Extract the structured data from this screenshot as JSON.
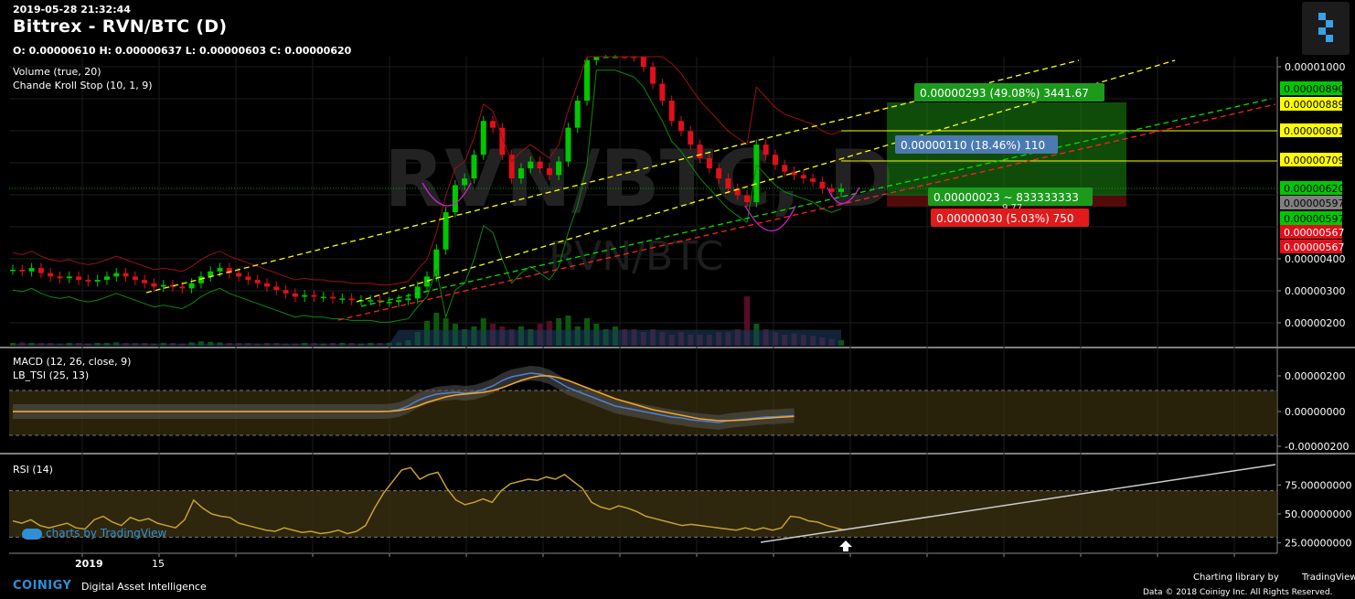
{
  "header": {
    "date": "2019-05-28 21:32:44",
    "title": "Bittrex - RVN/BTC (D)",
    "ohlc": "O: 0.00000610 H: 0.00000637 L: 0.00000603 C: 0.00000620"
  },
  "indicators": {
    "volume": "Volume (true, 20)",
    "chande": "Chande Kroll Stop (10, 1, 9)",
    "macd": "MACD (12, 26, close, 9)",
    "tsi": "LB_TSI (25, 13)",
    "rsi": "RSI (14)"
  },
  "watermark": {
    "big": "RVN/BTC, D",
    "small": "RVN/BTC"
  },
  "tv_watermark": "charts by TradingView",
  "footer": {
    "brand": "COINIGY",
    "tagline": "Digital Asset Intelligence",
    "charting": "Charting library by",
    "tv": "TradingView",
    "copyright": "Data © 2018 Coinigy Inc. All Rights Reserved."
  },
  "colors": {
    "up": "#00c800",
    "down": "#e0101b",
    "yellow_dash": "#ffff00",
    "green_dash": "#00e000",
    "red_dash": "#ff2020",
    "profit_zone": "#1c8a12",
    "loss_zone": "#8a1010",
    "macd_line": "#4f7fd8",
    "signal_line": "#f5a623",
    "rsi_line": "#c8a030",
    "rsi_band": "#3a3010",
    "axis_text": "#ffffff"
  },
  "chart_data": [
    {
      "type": "candlestick",
      "title": "Bittrex - RVN/BTC (D)",
      "ylim": [
        1.5e-06,
        1.01e-05
      ],
      "price_axis_ticks": [
        "0.00001000",
        "0.00000300",
        "0.00000200",
        "0.00000400"
      ],
      "x_tick_labels": [
        "2019",
        "15"
      ],
      "price_markers": [
        {
          "label": "0.00000890",
          "color": "#00c800"
        },
        {
          "label": "0.00000889",
          "color": "#ffff00"
        },
        {
          "label": "0.00000801",
          "color": "#ffff00"
        },
        {
          "label": "0.00000709",
          "color": "#ffff00"
        },
        {
          "label": "0.00000620",
          "color": "#00c800"
        },
        {
          "label": "0.00000597",
          "color": "#808080"
        },
        {
          "label": "0.00000597",
          "color": "#00c800"
        },
        {
          "label": "0.00000567",
          "color": "#e0101b"
        },
        {
          "label": "0.00000567",
          "color": "#e0101b"
        }
      ],
      "position": {
        "target_label": "0.00000293 (49.08%) 3441.67",
        "mid_label": "0.00000110 (18.46%) 110",
        "entry_label": "0.00000023 ~ 833333333",
        "ratio": "9.77",
        "stop_label": "0.00000030 (5.03%) 750"
      },
      "close_series": [
        3.8,
        3.75,
        3.85,
        3.7,
        3.6,
        3.55,
        3.6,
        3.5,
        3.45,
        3.5,
        3.6,
        3.7,
        3.6,
        3.5,
        3.4,
        3.3,
        3.35,
        3.3,
        3.25,
        3.4,
        3.6,
        3.75,
        3.85,
        3.7,
        3.6,
        3.5,
        3.4,
        3.3,
        3.2,
        3.1,
        3.0,
        3.05,
        3.0,
        3.0,
        2.95,
        2.95,
        2.9,
        2.9,
        2.9,
        2.85,
        2.85,
        2.9,
        2.95,
        3.3,
        3.6,
        4.4,
        5.5,
        6.3,
        6.5,
        7.2,
        8.2,
        8.0,
        7.2,
        6.5,
        6.8,
        7.0,
        6.8,
        6.6,
        7.0,
        8.0,
        8.8,
        10.0,
        10.3,
        10.3,
        10.3,
        10.2,
        10.1,
        9.8,
        9.3,
        8.8,
        8.2,
        7.9,
        7.5,
        7.1,
        6.8,
        6.5,
        6.2,
        6.0,
        5.8,
        7.5,
        7.2,
        6.9,
        6.7,
        6.6,
        6.5,
        6.4,
        6.2,
        6.1,
        6.2
      ],
      "volume": [
        0.05,
        0.06,
        0.05,
        0.05,
        0.05,
        0.04,
        0.05,
        0.05,
        0.04,
        0.05,
        0.05,
        0.06,
        0.05,
        0.05,
        0.05,
        0.04,
        0.05,
        0.05,
        0.04,
        0.06,
        0.08,
        0.07,
        0.06,
        0.05,
        0.05,
        0.05,
        0.04,
        0.05,
        0.05,
        0.04,
        0.04,
        0.05,
        0.05,
        0.04,
        0.05,
        0.05,
        0.05,
        0.04,
        0.05,
        0.05,
        0.05,
        0.06,
        0.1,
        0.25,
        0.45,
        0.6,
        0.5,
        0.4,
        0.3,
        0.35,
        0.5,
        0.4,
        0.35,
        0.3,
        0.35,
        0.3,
        0.4,
        0.45,
        0.5,
        0.55,
        0.35,
        0.5,
        0.4,
        0.3,
        0.35,
        0.3,
        0.3,
        0.25,
        0.3,
        0.25,
        0.2,
        0.25,
        0.2,
        0.2,
        0.2,
        0.25,
        0.25,
        0.3,
        0.9,
        0.4,
        0.3,
        0.25,
        0.2,
        0.22,
        0.2,
        0.18,
        0.15,
        0.12,
        0.1
      ]
    },
    {
      "type": "line",
      "title": "MACD (12, 26, close, 9)",
      "y_tick_labels": [
        "0.00000200",
        "0.00000000",
        "-0.00000200"
      ],
      "series": [
        {
          "name": "MACD",
          "values": [
            0,
            0,
            0,
            0,
            0,
            0,
            0,
            0,
            0,
            0,
            0,
            0,
            0,
            0,
            0,
            0,
            0,
            0,
            0,
            0,
            0,
            0,
            0,
            0,
            0,
            0,
            0,
            0,
            0,
            0,
            0,
            0,
            0,
            0,
            0,
            0,
            0,
            0,
            0,
            0,
            0.02,
            0.1,
            0.3,
            0.6,
            0.8,
            0.95,
            1.0,
            1.05,
            1.0,
            1.05,
            1.2,
            1.4,
            1.7,
            1.9,
            2.0,
            2.1,
            2.05,
            1.9,
            1.6,
            1.3,
            1.1,
            0.9,
            0.7,
            0.5,
            0.3,
            0.2,
            0.1,
            0,
            -0.1,
            -0.2,
            -0.3,
            -0.35,
            -0.45,
            -0.5,
            -0.55,
            -0.6,
            -0.5,
            -0.45,
            -0.4,
            -0.35,
            -0.3,
            -0.28,
            -0.25,
            -0.22
          ]
        },
        {
          "name": "Signal",
          "values": [
            0,
            0,
            0,
            0,
            0,
            0,
            0,
            0,
            0,
            0,
            0,
            0,
            0,
            0,
            0,
            0,
            0,
            0,
            0,
            0,
            0,
            0,
            0,
            0,
            0,
            0,
            0,
            0,
            0,
            0,
            0,
            0,
            0,
            0,
            0,
            0,
            0,
            0,
            0,
            0,
            0.01,
            0.05,
            0.15,
            0.3,
            0.5,
            0.65,
            0.8,
            0.9,
            0.95,
            1.0,
            1.05,
            1.15,
            1.3,
            1.5,
            1.7,
            1.85,
            1.95,
            1.95,
            1.85,
            1.7,
            1.5,
            1.3,
            1.1,
            0.9,
            0.7,
            0.55,
            0.4,
            0.25,
            0.1,
            0,
            -0.1,
            -0.2,
            -0.3,
            -0.4,
            -0.45,
            -0.5,
            -0.5,
            -0.48,
            -0.45,
            -0.4,
            -0.37,
            -0.33,
            -0.3,
            -0.27
          ]
        }
      ]
    },
    {
      "type": "line",
      "title": "RSI (14)",
      "y_tick_labels": [
        "75.00000000",
        "50.00000000",
        "25.00000000"
      ],
      "ylim": [
        20,
        95
      ],
      "bands": [
        30,
        70
      ],
      "series": [
        {
          "name": "RSI",
          "values": [
            44,
            42,
            45,
            40,
            38,
            40,
            42,
            38,
            37,
            45,
            48,
            43,
            40,
            47,
            44,
            46,
            42,
            40,
            38,
            45,
            62,
            55,
            50,
            48,
            47,
            42,
            40,
            38,
            36,
            35,
            38,
            36,
            34,
            35,
            33,
            34,
            36,
            33,
            35,
            40,
            55,
            68,
            78,
            88,
            90,
            80,
            84,
            86,
            72,
            62,
            58,
            60,
            63,
            60,
            70,
            76,
            78,
            80,
            79,
            82,
            80,
            84,
            78,
            72,
            60,
            56,
            54,
            57,
            55,
            52,
            48,
            46,
            44,
            42,
            40,
            41,
            40,
            39,
            38,
            37,
            36,
            38,
            36,
            38,
            36,
            38,
            48,
            47,
            44,
            43,
            40,
            38,
            36
          ]
        }
      ],
      "trendline": "rising support"
    }
  ]
}
